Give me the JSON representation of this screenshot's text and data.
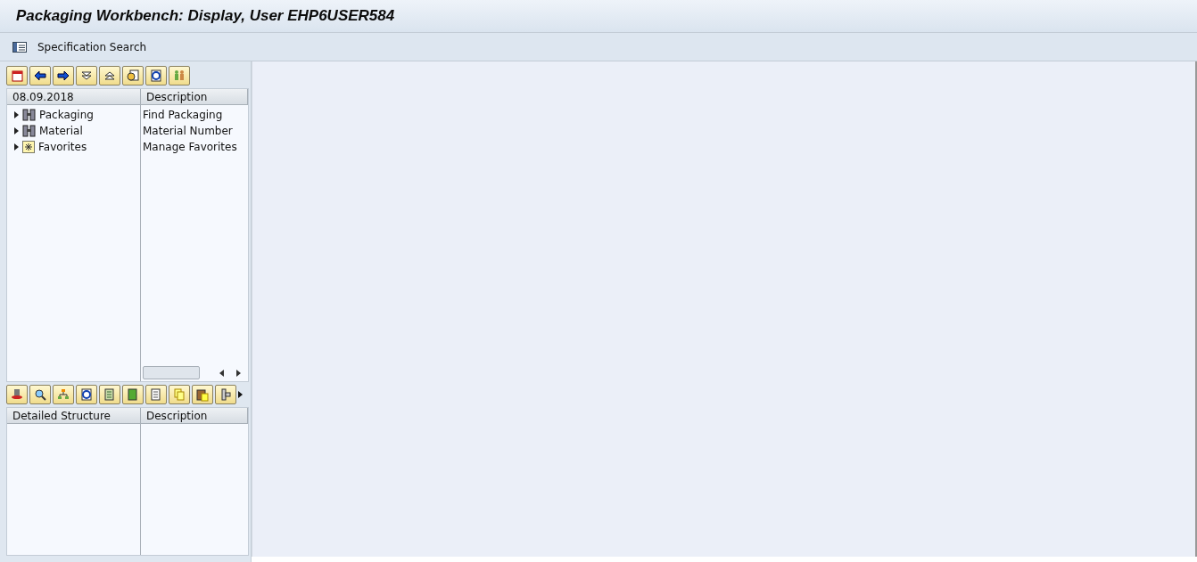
{
  "window": {
    "title": "Packaging Workbench: Display, User EHP6USER584"
  },
  "toolbar": {
    "button": "Specification Search"
  },
  "search_tree": {
    "columns": [
      "08.09.2018",
      "Description"
    ],
    "rows": [
      {
        "label": "Packaging",
        "description": "Find Packaging",
        "expanded": false,
        "kind": "binoculars"
      },
      {
        "label": "Material",
        "description": "Material Number",
        "expanded": false,
        "kind": "binoculars"
      },
      {
        "label": "Favorites",
        "description": "Manage Favorites",
        "expanded": false,
        "kind": "star"
      }
    ]
  },
  "structure_tree": {
    "columns": [
      "Detailed Structure",
      "Description"
    ]
  }
}
